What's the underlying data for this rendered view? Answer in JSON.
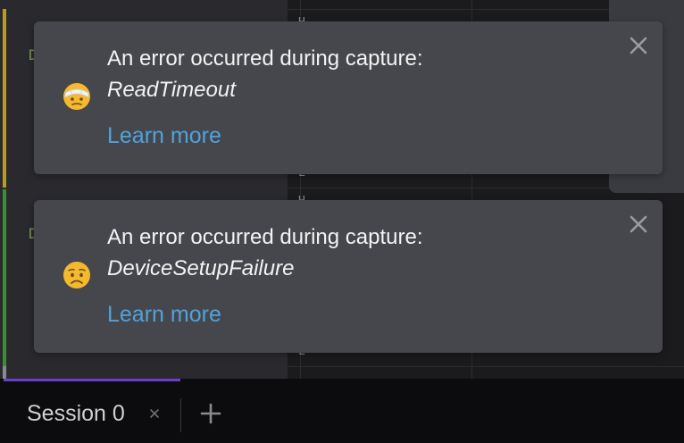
{
  "colors": {
    "toast_bg": "#46474c",
    "link": "#4ea3dc",
    "tab_accent": "#6a3fc9",
    "app_bg": "#1b1b1e"
  },
  "notifications": [
    {
      "title": "An error occurred during capture:",
      "detail": "ReadTimeout",
      "link_label": "Learn more",
      "emoji_icon": "face-with-head-bandage-icon",
      "close_icon": "close-icon"
    },
    {
      "title": "An error occurred during capture:",
      "detail": "DeviceSetupFailure",
      "link_label": "Learn more",
      "emoji_icon": "worried-face-icon",
      "close_icon": "close-icon"
    }
  ],
  "tabbar": {
    "tabs": [
      {
        "label": "Session 0",
        "close_glyph": "×"
      }
    ],
    "add_tab_icon": "plus-icon"
  }
}
